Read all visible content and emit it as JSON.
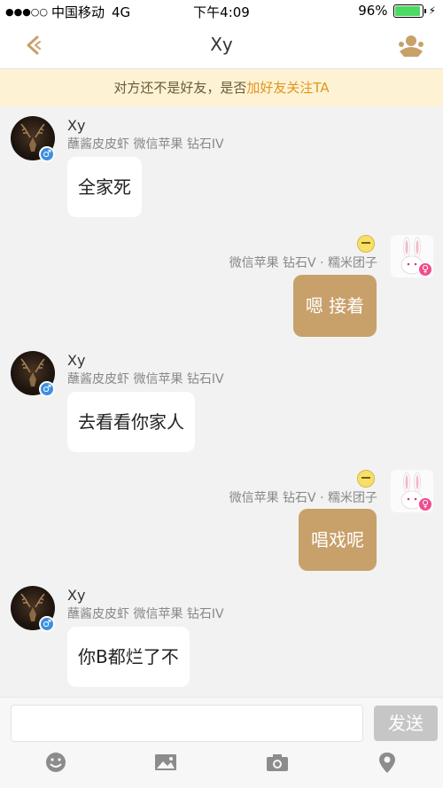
{
  "status_bar": {
    "signal": "●●●○○",
    "carrier": "中国移动",
    "network": "4G",
    "time": "下午4:09",
    "battery": "96%",
    "battery_level": 0.96
  },
  "nav": {
    "title": "Xy",
    "back_icon": "chevron-left-icon",
    "profile_icon": "user-group-icon"
  },
  "notice": {
    "text": "对方还不是好友，是否",
    "link": "加好友关注TA"
  },
  "messages": [
    {
      "direction": "in",
      "name": "Xy",
      "meta": "蘸酱皮皮虾 微信苹果 钻石IV",
      "text": "全家死"
    },
    {
      "direction": "out",
      "meta": "微信苹果 钻石V · 糯米团子",
      "text": "嗯 接着"
    },
    {
      "direction": "in",
      "name": "Xy",
      "meta": "蘸酱皮皮虾 微信苹果 钻石IV",
      "text": "去看看你家人"
    },
    {
      "direction": "out",
      "meta": "微信苹果 钻石V · 糯米团子",
      "text": "唱戏呢"
    },
    {
      "direction": "in",
      "name": "Xy",
      "meta": "蘸酱皮皮虾 微信苹果 钻石IV",
      "text": "你B都烂了不"
    }
  ],
  "input": {
    "value": "",
    "placeholder": "",
    "send_label": "发送"
  },
  "toolbar": [
    "emoji-icon",
    "image-icon",
    "camera-icon",
    "location-icon"
  ],
  "colors": {
    "accent": "#c8a06a",
    "notice_bg": "#fdf3d4",
    "notice_link": "#e29420",
    "male_badge": "#3d8fe0",
    "female_badge": "#ee4d8e"
  }
}
